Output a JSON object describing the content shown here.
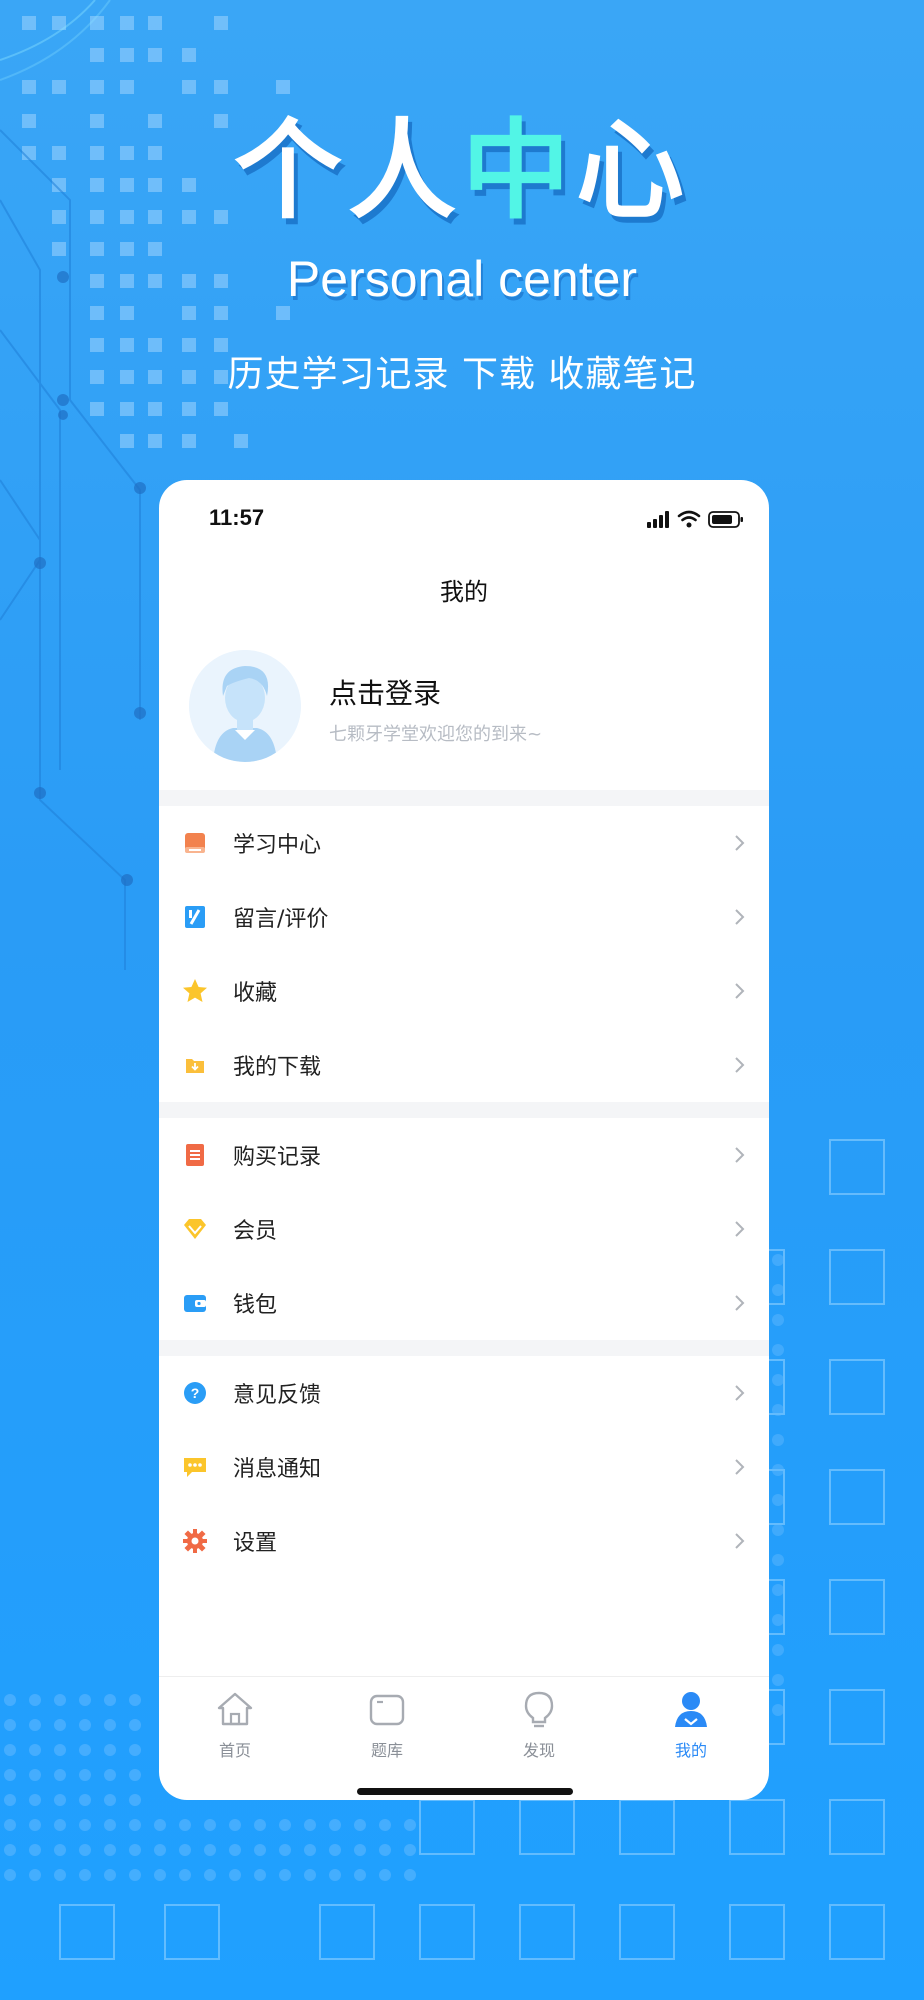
{
  "hero": {
    "title_part1": "个人",
    "title_part2": "中",
    "title_part3": "心",
    "subtitle_en": "Personal center",
    "tagline": "历史学习记录 下载 收藏笔记"
  },
  "status_bar": {
    "time": "11:57"
  },
  "page": {
    "title": "我的"
  },
  "profile": {
    "login_label": "点击登录",
    "welcome": "七颗牙学堂欢迎您的到来~"
  },
  "menu_groups": [
    [
      {
        "label": "学习中心",
        "icon": "book-icon"
      },
      {
        "label": "留言/评价",
        "icon": "comment-icon"
      },
      {
        "label": "收藏",
        "icon": "star-icon"
      },
      {
        "label": "我的下载",
        "icon": "download-folder-icon"
      }
    ],
    [
      {
        "label": "购买记录",
        "icon": "receipt-icon"
      },
      {
        "label": "会员",
        "icon": "diamond-icon"
      },
      {
        "label": "钱包",
        "icon": "wallet-icon"
      }
    ],
    [
      {
        "label": "意见反馈",
        "icon": "question-icon"
      },
      {
        "label": "消息通知",
        "icon": "message-icon"
      },
      {
        "label": "设置",
        "icon": "settings-icon"
      }
    ]
  ],
  "tabs": [
    {
      "label": "首页",
      "icon": "home-icon",
      "active": false
    },
    {
      "label": "题库",
      "icon": "question-bank-icon",
      "active": false
    },
    {
      "label": "发现",
      "icon": "bulb-icon",
      "active": false
    },
    {
      "label": "我的",
      "icon": "user-icon",
      "active": true
    }
  ],
  "colors": {
    "accent": "#2a8af6",
    "background_blue": "#2a9cf6",
    "title_cyan": "#52f5e6"
  }
}
